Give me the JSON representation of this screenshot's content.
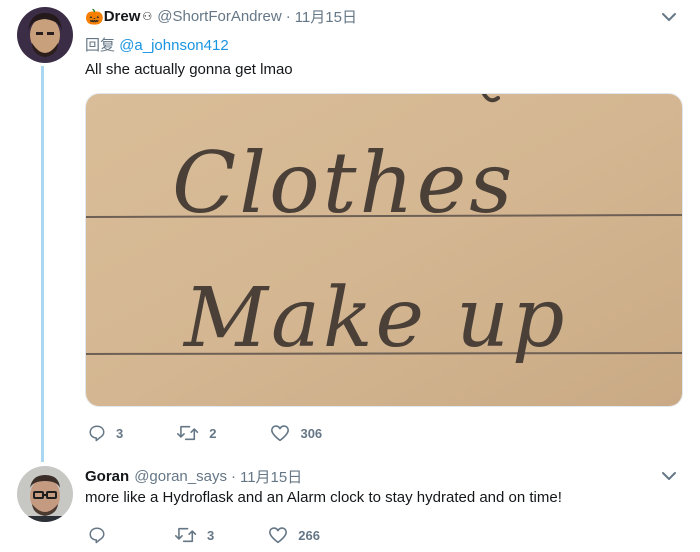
{
  "tweet1": {
    "name_emoji": "🎃",
    "name": "Drew",
    "name_suffix": "⚇",
    "handle": "@ShortForAndrew",
    "dot": "·",
    "time": "11月15日",
    "reply_prefix": "回复",
    "reply_to": "@a_johnson412",
    "text": "All she actually gonna get lmao",
    "image_text": [
      "Clothes",
      "Make up"
    ],
    "replies": "3",
    "retweets": "2",
    "likes": "306"
  },
  "tweet2": {
    "name": "Goran",
    "handle": "@goran_says",
    "dot": "·",
    "time": "11月15日",
    "text": "more like a Hydroflask and an Alarm clock to stay hydrated and on time!",
    "replies": "",
    "retweets": "3",
    "likes": "266"
  },
  "colors": {
    "accent": "#1b95e0",
    "muted": "#657786",
    "thread": "#a9d7f0",
    "paper": "#d6ba95"
  },
  "icons": [
    "chevron-down-icon",
    "reply-icon",
    "retweet-icon",
    "like-icon"
  ]
}
